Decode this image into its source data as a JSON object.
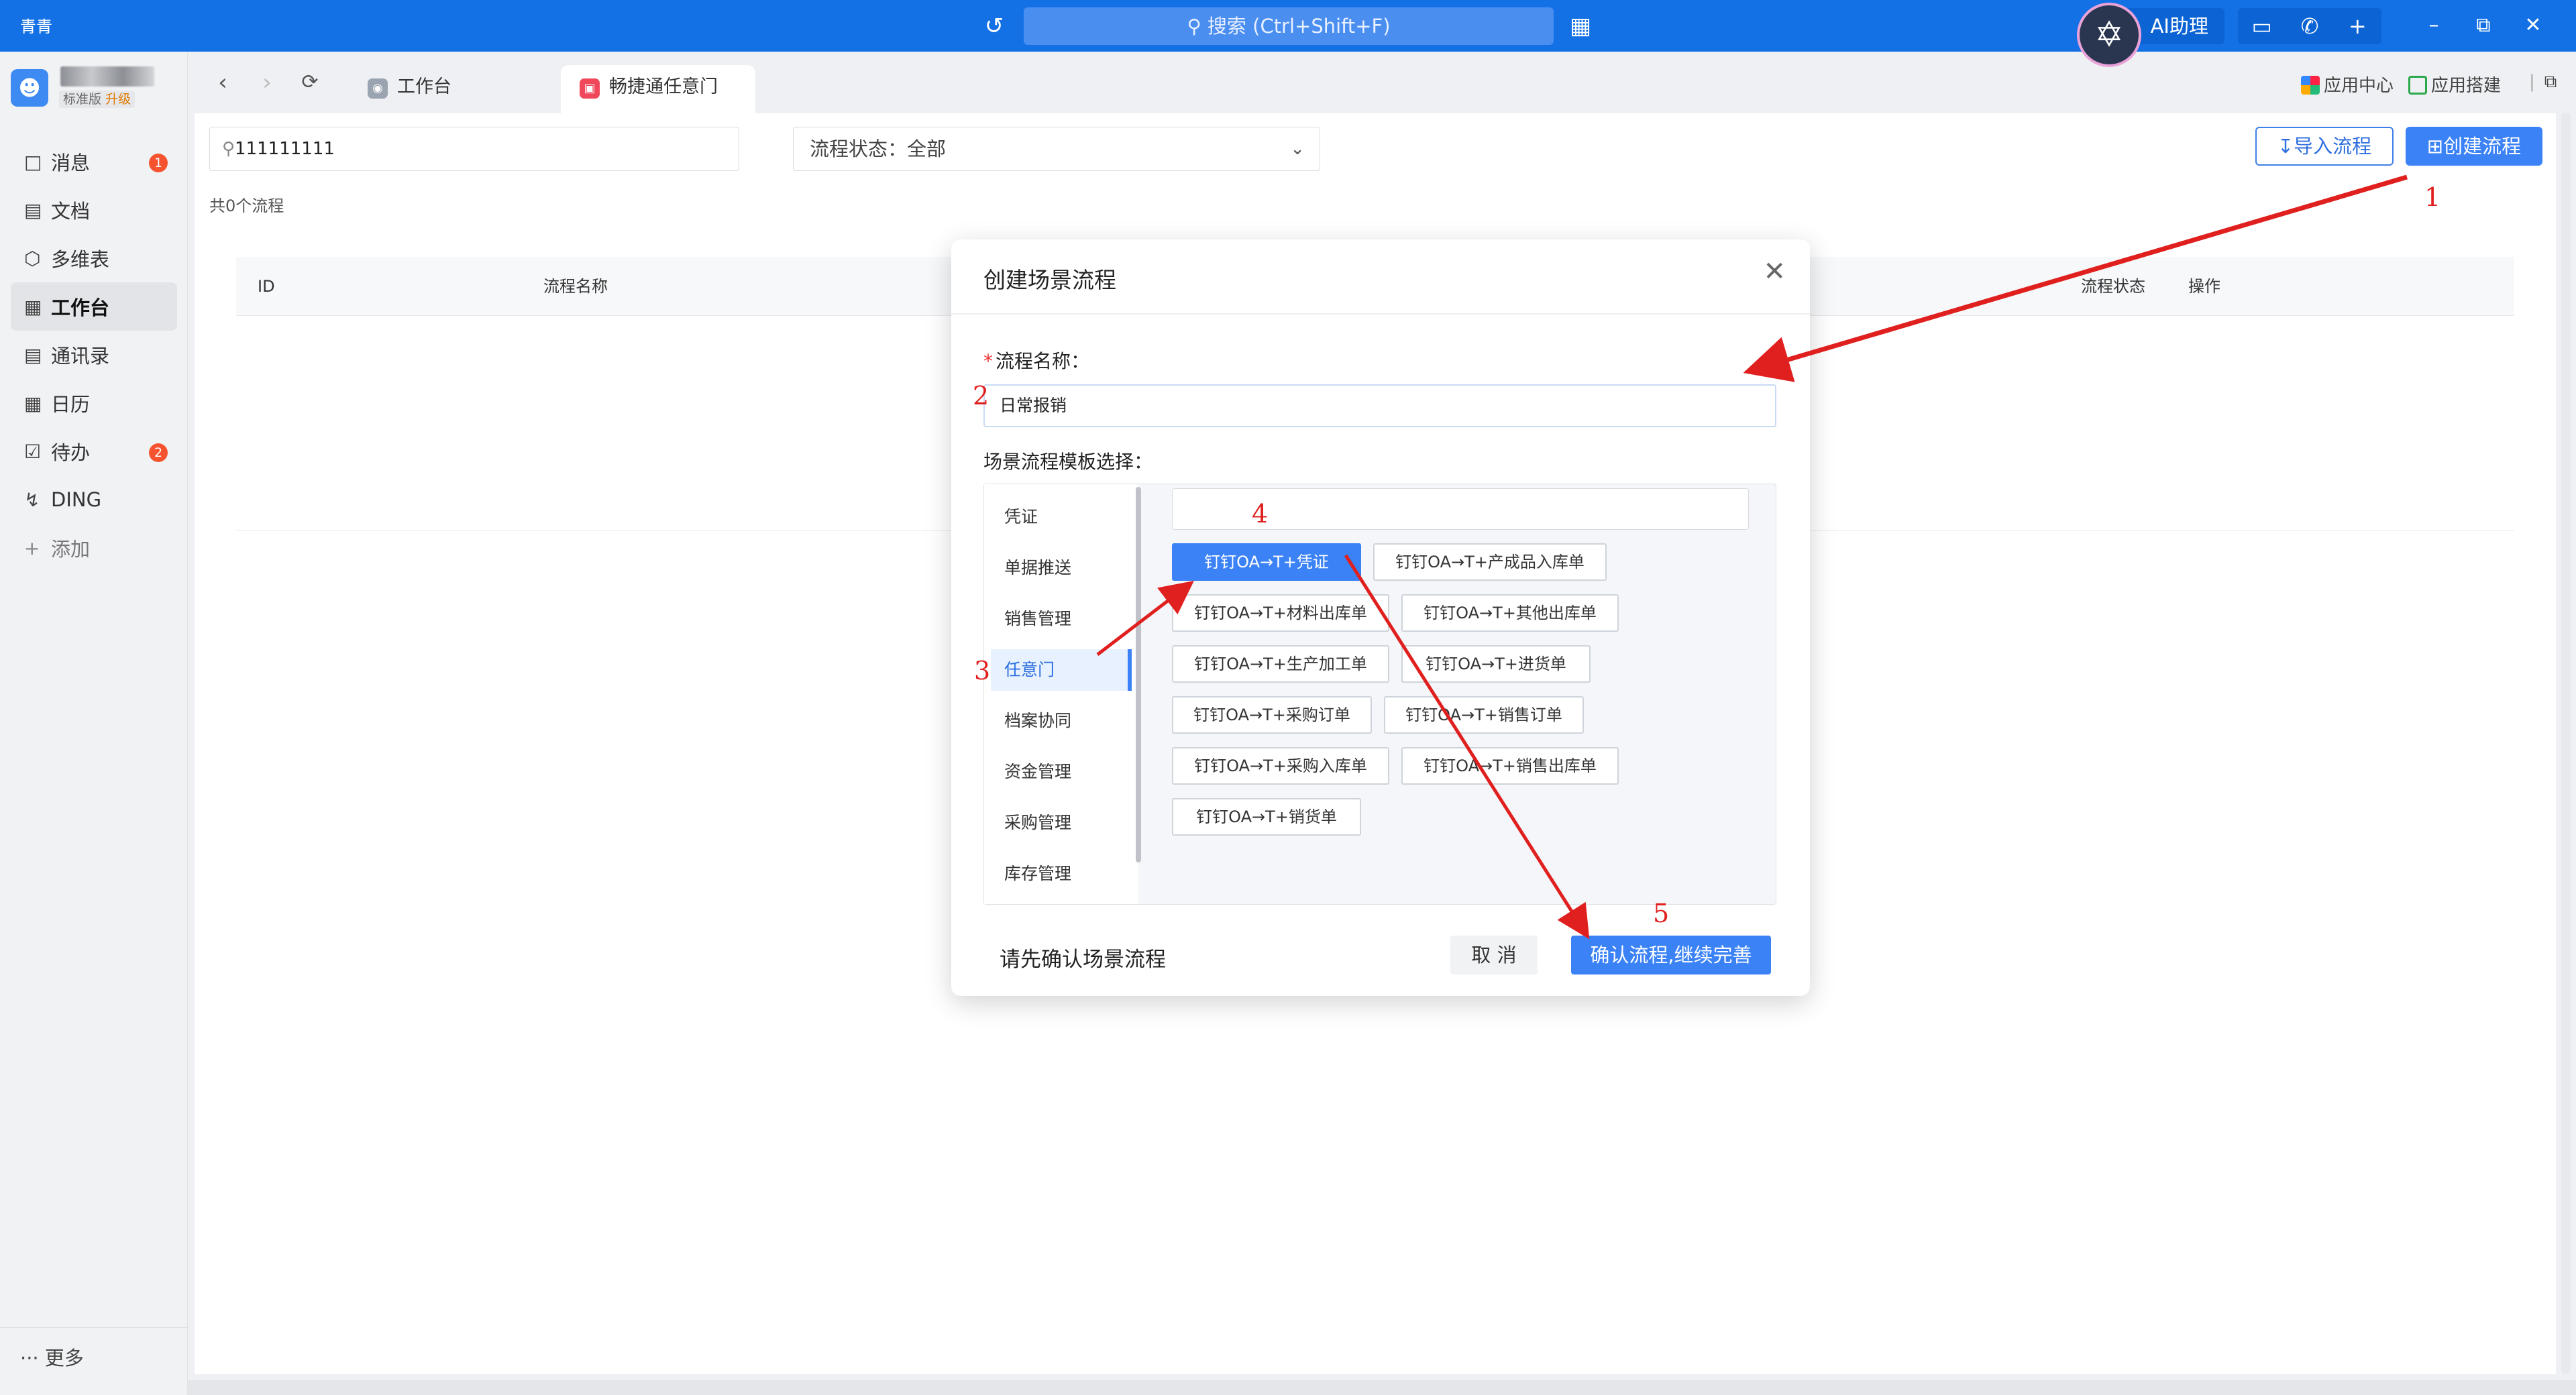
{
  "topbar": {
    "app_name": "青青",
    "search_placeholder": "搜索 (Ctrl+Shift+F)",
    "ai_label": "AI助理",
    "accent": "#1471e5"
  },
  "sidebar": {
    "org_edition": "标准版",
    "org_upgrade": "升级",
    "items": [
      {
        "label": "消息",
        "icon": "message-icon",
        "badge": "1"
      },
      {
        "label": "文档",
        "icon": "document-icon",
        "badge": ""
      },
      {
        "label": "多维表",
        "icon": "table-icon",
        "badge": ""
      },
      {
        "label": "工作台",
        "icon": "workbench-icon",
        "badge": "",
        "active": true
      },
      {
        "label": "通讯录",
        "icon": "contacts-icon",
        "badge": ""
      },
      {
        "label": "日历",
        "icon": "calendar-icon",
        "badge": ""
      },
      {
        "label": "待办",
        "icon": "todo-icon",
        "badge": "2"
      },
      {
        "label": "DING",
        "icon": "ding-icon",
        "badge": ""
      },
      {
        "label": "添加",
        "icon": "plus-icon",
        "badge": ""
      }
    ],
    "more": "更多"
  },
  "tabs": {
    "items": [
      {
        "label": "工作台",
        "active": false
      },
      {
        "label": "畅捷通任意门",
        "active": true
      }
    ],
    "app_center": "应用中心",
    "app_build": "应用搭建"
  },
  "page": {
    "search_value": "111111111",
    "status_filter": "流程状态：全部",
    "import_button": "导入流程",
    "create_button": "创建流程",
    "count_text": "共0个流程",
    "columns": [
      "ID",
      "流程名称",
      "流程状态",
      "操作"
    ]
  },
  "dialog": {
    "title": "创建场景流程",
    "name_label": "流程名称：",
    "name_value": "日常报销",
    "template_label": "场景流程模板选择：",
    "categories": [
      "凭证",
      "单据推送",
      "销售管理",
      "任意门",
      "档案协同",
      "资金管理",
      "采购管理",
      "库存管理"
    ],
    "selected_category": "任意门",
    "templates": [
      "钉钉OA→T+凭证",
      "钉钉OA→T+产成品入库单",
      "钉钉OA→T+材料出库单",
      "钉钉OA→T+其他出库单",
      "钉钉OA→T+生产加工单",
      "钉钉OA→T+进货单",
      "钉钉OA→T+采购订单",
      "钉钉OA→T+销售订单",
      "钉钉OA→T+采购入库单",
      "钉钉OA→T+销售出库单",
      "钉钉OA→T+销货单"
    ],
    "selected_template": "钉钉OA→T+凭证",
    "hint": "请先确认场景流程",
    "cancel": "取 消",
    "confirm": "确认流程,继续完善"
  },
  "annotations": {
    "numbers": [
      "1",
      "2",
      "3",
      "4",
      "5"
    ],
    "color": "#e0201f"
  }
}
